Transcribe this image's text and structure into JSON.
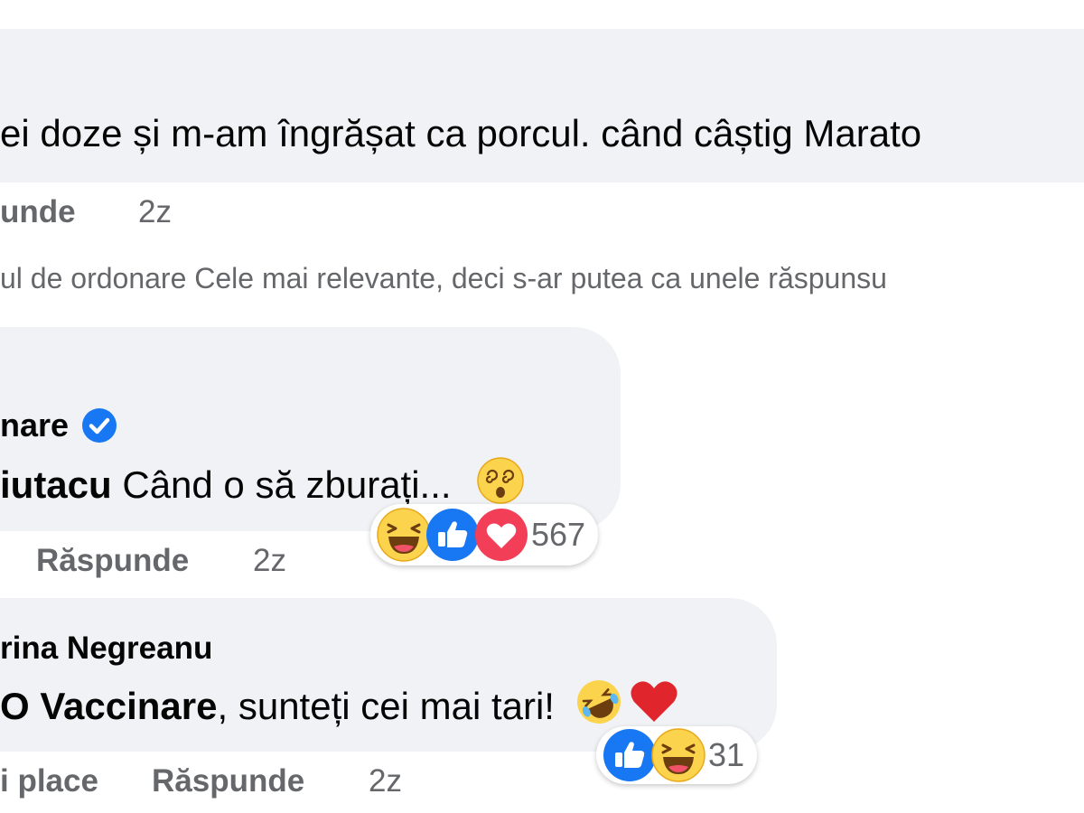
{
  "top_comment": {
    "text": "ei doze și m-am îngrășat ca porcul. când câștig Marato",
    "reply_label": "unde",
    "time": "2z"
  },
  "sort_notice": "ul de ordonare Cele mai relevante, deci s-ar putea ca unele răspunsu",
  "reply1": {
    "author": "nare",
    "mention": "iutacu",
    "text": " Când o să zburați... ",
    "reply_label": "Răspunde",
    "time": "2z",
    "reaction_count": "567",
    "reactions": [
      "laughing-icon",
      "like-icon",
      "love-icon"
    ]
  },
  "reply2": {
    "author": "rina Negreanu",
    "mention": "O Vaccinare",
    "text": ", sunteți cei mai tari! ",
    "like_label": "i place",
    "reply_label": "Răspunde",
    "time": "2z",
    "reaction_count": "31",
    "reactions": [
      "like-icon",
      "laughing-icon"
    ]
  },
  "colors": {
    "bubble": "#f0f2f5",
    "secondary_text": "#65676b",
    "like_blue": "#1877f2",
    "love_red": "#f33e58",
    "haha_yellow": "#fcd34d"
  }
}
